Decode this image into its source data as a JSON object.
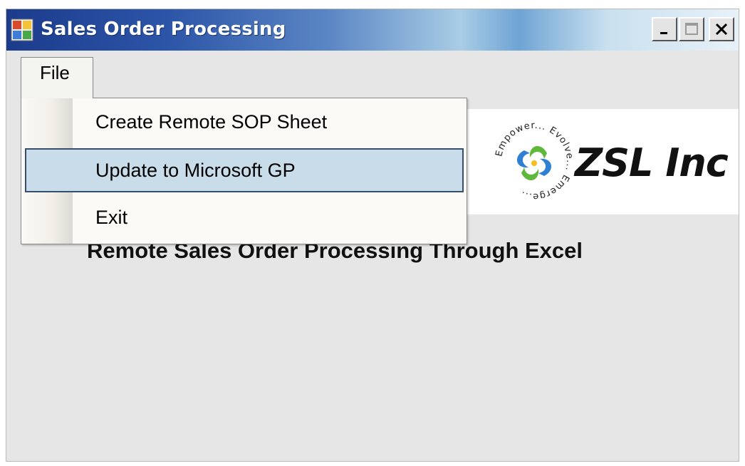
{
  "window": {
    "title": "Sales Order Processing",
    "controls": {
      "minimize": "_",
      "maximize": "□",
      "close": "X"
    }
  },
  "menubar": {
    "file_label": "File"
  },
  "file_menu": {
    "items": [
      {
        "label": "Create Remote SOP Sheet"
      },
      {
        "label": "Update to Microsoft GP",
        "highlighted": true
      },
      {
        "label": "Exit"
      }
    ]
  },
  "logo": {
    "company": "ZSL Inc",
    "seal_text": "Empower... Evolve... Emerge..."
  },
  "main": {
    "subtitle": "Remote Sales Order Processing Through Excel"
  },
  "colors": {
    "titlebar_dark": "#1c3b8c",
    "menu_highlight": "#c8dde9",
    "menu_highlight_border": "#36506b",
    "window_bg": "#e6e6e6"
  }
}
